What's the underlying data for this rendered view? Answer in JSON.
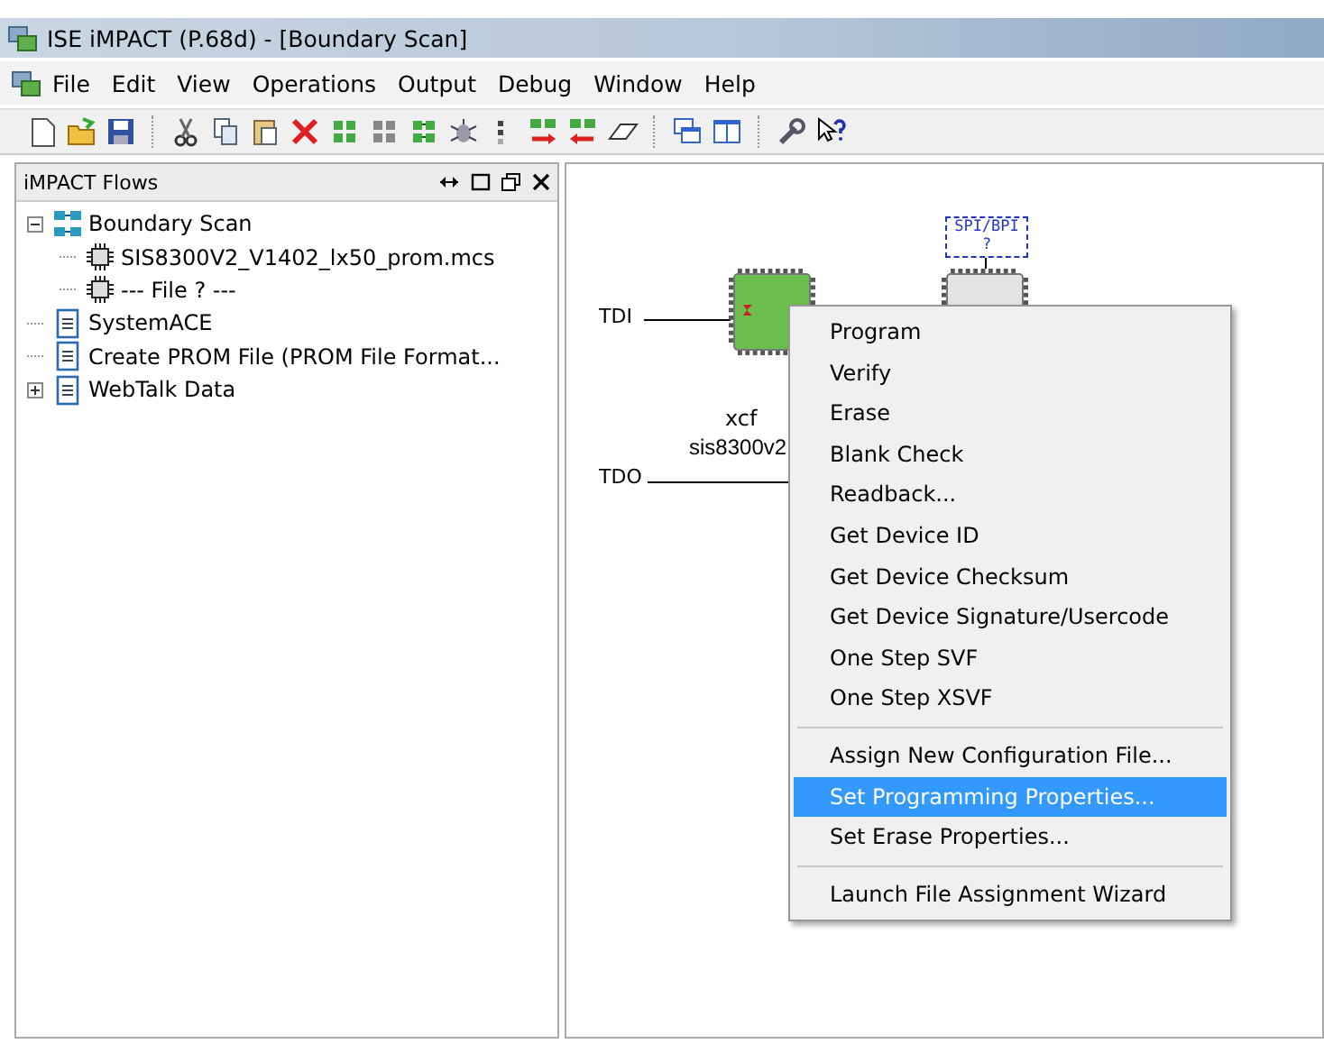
{
  "window": {
    "title": "ISE iMPACT (P.68d) - [Boundary Scan]"
  },
  "menu_bar": [
    "File",
    "Edit",
    "View",
    "Operations",
    "Output",
    "Debug",
    "Window",
    "Help"
  ],
  "flows_panel": {
    "title": "iMPACT Flows",
    "tree": [
      {
        "label": "Boundary Scan",
        "kind": "chain",
        "expanded": true,
        "children": [
          {
            "label": "SIS8300V2_V1402_lx50_prom.mcs",
            "kind": "chip"
          },
          {
            "label": "--- File ? ---",
            "kind": "chip"
          }
        ]
      },
      {
        "label": "SystemACE",
        "kind": "doc"
      },
      {
        "label": "Create PROM File (PROM File Format...",
        "kind": "doc"
      },
      {
        "label": "WebTalk Data",
        "kind": "doc",
        "expanded": false
      }
    ]
  },
  "canvas": {
    "tdi": "TDI",
    "tdo": "TDO",
    "devices": [
      {
        "kind": "assigned",
        "name": "xcf",
        "file": "sis8300v2"
      },
      {
        "kind": "unassigned",
        "badge": "SPI/BPI",
        "badge_note": "?"
      }
    ]
  },
  "context_menu": {
    "groups": [
      [
        {
          "label": "Program",
          "selected": false
        },
        {
          "label": "Verify",
          "selected": false
        },
        {
          "label": "Erase",
          "selected": false
        },
        {
          "label": "Blank Check",
          "selected": false
        },
        {
          "label": "Readback...",
          "selected": false
        },
        {
          "label": "Get Device ID",
          "selected": false
        },
        {
          "label": "Get Device Checksum",
          "selected": false
        },
        {
          "label": "Get Device Signature/Usercode",
          "selected": false
        },
        {
          "label": "One Step SVF",
          "selected": false
        },
        {
          "label": "One Step XSVF",
          "selected": false
        }
      ],
      [
        {
          "label": "Assign New Configuration File...",
          "selected": false
        },
        {
          "label": "Set Programming Properties...",
          "selected": true
        },
        {
          "label": "Set Erase Properties...",
          "selected": false
        }
      ],
      [
        {
          "label": "Launch File Assignment Wizard",
          "selected": false
        }
      ]
    ]
  }
}
